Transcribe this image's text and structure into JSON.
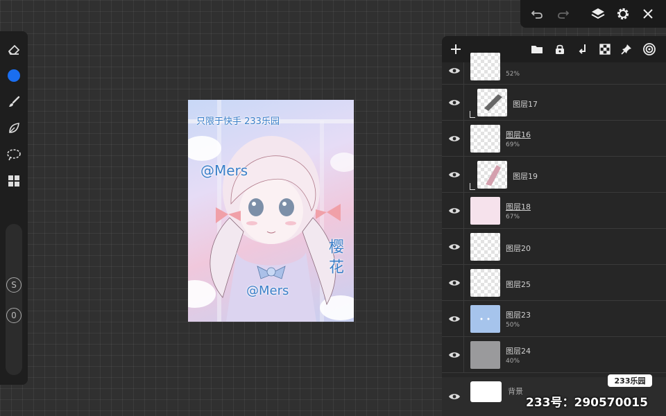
{
  "left_toolbar": {
    "tools": [
      {
        "icon": "eraser-icon"
      },
      {
        "icon": "color-swatch",
        "color": "#1a6ef0"
      },
      {
        "icon": "brush-icon"
      },
      {
        "icon": "leaf-icon"
      },
      {
        "icon": "lasso-icon"
      },
      {
        "icon": "grid-icon"
      }
    ],
    "size_label": "S",
    "opacity_label": "0"
  },
  "top_bar": {
    "buttons": [
      "undo-icon",
      "redo-icon",
      "layers-icon",
      "gear-icon",
      "close-icon"
    ]
  },
  "canvas": {
    "text_top": "只限于快手 233乐园",
    "text_sig_1": "@Mers",
    "text_sig_2": "@Mers",
    "text_side": "樱 花"
  },
  "layers_header": {
    "buttons": [
      "add-layer-icon",
      "folder-icon",
      "lock-icon",
      "merge-down-icon",
      "checker-icon",
      "pin-icon",
      "target-icon"
    ]
  },
  "layers": [
    {
      "name": "",
      "opacity": "52%"
    },
    {
      "name": "图层17",
      "opacity": "",
      "clipped": true
    },
    {
      "name": "图层16",
      "opacity": "69%"
    },
    {
      "name": "图层19",
      "opacity": "",
      "clipped": true
    },
    {
      "name": "图层18",
      "opacity": "67%"
    },
    {
      "name": "图层20",
      "opacity": ""
    },
    {
      "name": "图层25",
      "opacity": ""
    },
    {
      "name": "图层23",
      "opacity": "50%"
    },
    {
      "name": "图层24",
      "opacity": "40%"
    }
  ],
  "background_layer": {
    "name": "背景"
  },
  "watermark": {
    "badge": "233乐园",
    "id_text": "233号：290570015"
  },
  "colors": {
    "accent_blue": "#1a6ef0",
    "panel_bg": "#262626",
    "canvas_bg": "#303030"
  }
}
